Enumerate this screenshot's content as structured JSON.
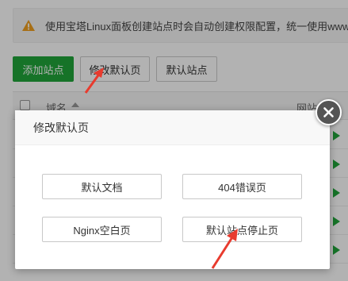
{
  "notice": {
    "icon": "warning-icon",
    "text": "使用宝塔Linux面板创建站点时会自动创建权限配置，统一使用www用户"
  },
  "toolbar": {
    "add_site": "添加站点",
    "edit_default_page": "修改默认页",
    "default_site": "默认站点"
  },
  "table": {
    "col_name": "域名",
    "col_dir": "网站目"
  },
  "modal": {
    "title": "修改默认页",
    "options": [
      "默认文档",
      "404错误页",
      "Nginx空白页",
      "默认站点停止页"
    ]
  },
  "colors": {
    "accent_green": "#20a53a",
    "annotation_red": "#e83b2e",
    "warning_orange": "#f0a020"
  }
}
